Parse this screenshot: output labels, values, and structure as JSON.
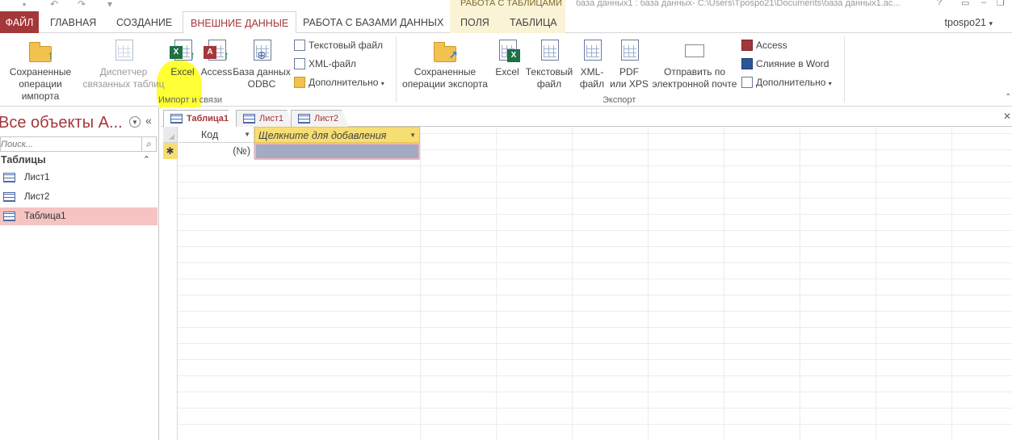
{
  "titlebar": {
    "context_group": "РАБОТА С ТАБЛИЦАМИ",
    "document_title": "база данных1 : база данных- C:\\Users\\Tpospo21\\Documents\\база данных1.ac..."
  },
  "tabs": {
    "file": "ФАЙЛ",
    "home": "ГЛАВНАЯ",
    "create": "СОЗДАНИЕ",
    "external": "ВНЕШНИЕ ДАННЫЕ",
    "database_tools": "РАБОТА С БАЗАМИ ДАННЫХ",
    "fields": "ПОЛЯ",
    "table": "ТАБЛИЦА"
  },
  "user": "tpospo21",
  "ribbon": {
    "import": {
      "saved_imports": [
        "Сохраненные",
        "операции импорта"
      ],
      "linked_table_manager": [
        "Диспетчер",
        "связанных таблиц"
      ],
      "excel": "Excel",
      "access": "Access",
      "odbc": [
        "База данных",
        "ODBC"
      ],
      "text_file": "Текстовый файл",
      "xml_file": "XML-файл",
      "more": "Дополнительно",
      "group_label": "Импорт и связи"
    },
    "export": {
      "saved_exports": [
        "Сохраненные",
        "операции экспорта"
      ],
      "excel": "Excel",
      "text_file": [
        "Текстовый",
        "файл"
      ],
      "xml_file": [
        "XML-",
        "файл"
      ],
      "pdf": [
        "PDF",
        "или XPS"
      ],
      "email": [
        "Отправить по",
        "электронной почте"
      ],
      "access": "Access",
      "word_merge": "Слияние в Word",
      "more": "Дополнительно",
      "group_label": "Экспорт"
    }
  },
  "nav": {
    "title": "Все объекты A...",
    "search_placeholder": "Поиск...",
    "group": "Таблицы",
    "items": [
      {
        "label": "Лист1"
      },
      {
        "label": "Лист2"
      },
      {
        "label": "Таблица1"
      }
    ]
  },
  "doc_tabs": [
    {
      "label": "Таблица1"
    },
    {
      "label": "Лист1"
    },
    {
      "label": "Лист2"
    }
  ],
  "grid": {
    "columns": [
      "Код",
      "Щелкните для добавления"
    ],
    "new_row_marker": "✱",
    "new_row_value": "(№)"
  },
  "icons": {
    "saved_imports": "folder-import-icon",
    "excel": "excel-icon",
    "access": "access-icon",
    "search": "search-icon",
    "table": "table-icon"
  },
  "colors": {
    "accent": "#a4373a",
    "context_tab_bg": "#faf3d6",
    "header_add": "#f7de73",
    "selected_nav": "#f6c3c3",
    "highlight": "#ffff35"
  }
}
